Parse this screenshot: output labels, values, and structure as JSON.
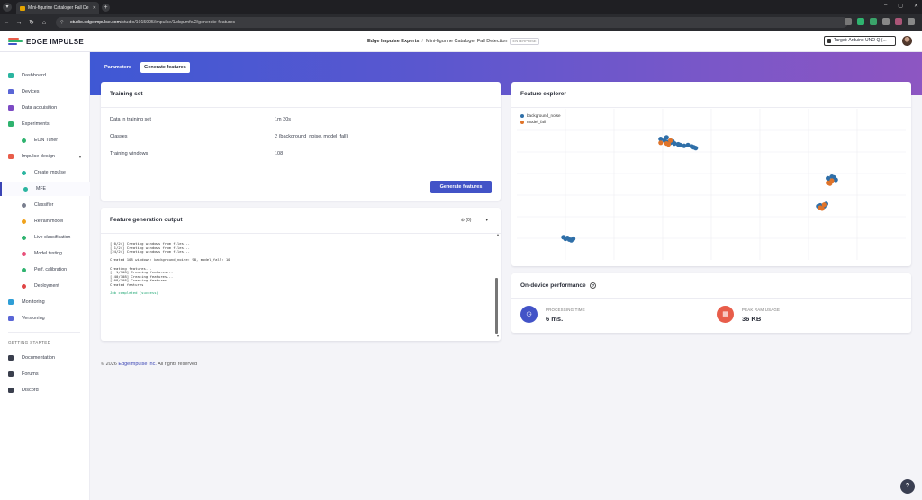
{
  "browser": {
    "tab_title": "Mini-figurine Cataloger Fall De",
    "tab_close": "✕",
    "new_tab": "+",
    "url_host": "studio.edgeimpulse.com",
    "url_path": "/studio/1015905/impulse/1/dsp/mfe/2/generate-features",
    "controls": {
      "min": "–",
      "max": "▢",
      "close": "✕"
    }
  },
  "header": {
    "logo_text": "EDGE IMPULSE",
    "org": "Edge Impulse Experts",
    "separator": "/",
    "project": "Mini-figurine Cataloger Fall Detection",
    "plan_badge": "ENTERPRISE",
    "target": "Target: Arduino UNO Q (...",
    "brand_color": "#4253c7"
  },
  "sidebar": {
    "items": [
      {
        "label": "Dashboard",
        "icon": "monitor-icon",
        "color": "#2bb5a0"
      },
      {
        "label": "Devices",
        "icon": "devices-icon",
        "color": "#5a66d6"
      },
      {
        "label": "Data acquisition",
        "icon": "database-icon",
        "color": "#7c4bc4"
      },
      {
        "label": "Experiments",
        "icon": "experiments-icon",
        "color": "#2fb36f"
      },
      {
        "label": "EON Tuner",
        "icon": "tuner-icon",
        "color": "#2fb36f"
      },
      {
        "label": "Impulse design",
        "icon": "impulse-icon",
        "color": "#e85d4a"
      },
      {
        "label": "Create impulse",
        "icon": "create-impulse-icon",
        "color": "#2bb5a0"
      },
      {
        "label": "MFE",
        "icon": "mfe-icon",
        "color": "#2bb5a0"
      },
      {
        "label": "Classifier",
        "icon": "classifier-icon",
        "color": "#7a7f8f"
      },
      {
        "label": "Retrain model",
        "icon": "retrain-icon",
        "color": "#f0a21b"
      },
      {
        "label": "Live classification",
        "icon": "live-icon",
        "color": "#2fb36f"
      },
      {
        "label": "Model testing",
        "icon": "testing-icon",
        "color": "#e8507a"
      },
      {
        "label": "Perf. calibration",
        "icon": "calibration-icon",
        "color": "#2fb36f"
      },
      {
        "label": "Deployment",
        "icon": "deployment-icon",
        "color": "#e04545"
      },
      {
        "label": "Monitoring",
        "icon": "monitoring-icon",
        "color": "#2f9ed6"
      },
      {
        "label": "Versioning",
        "icon": "versioning-icon",
        "color": "#5a66d6"
      }
    ],
    "section_label": "GETTING STARTED",
    "getting_started": [
      {
        "label": "Documentation",
        "icon": "documentation-icon"
      },
      {
        "label": "Forums",
        "icon": "forums-icon"
      },
      {
        "label": "Discord",
        "icon": "discord-icon"
      }
    ]
  },
  "tabs": {
    "parameters": "Parameters",
    "generate": "Generate features"
  },
  "training_set": {
    "title": "Training set",
    "rows": [
      {
        "key": "Data in training set",
        "value": "1m 30s"
      },
      {
        "key": "Classes",
        "value": "2 (background_noise, model_fall)"
      },
      {
        "key": "Training windows",
        "value": "108"
      }
    ],
    "button": "Generate features"
  },
  "output": {
    "title": "Feature generation output",
    "filter_count": "(0)",
    "lines": [
      "[ 0/24] Creating windows from files...",
      "[ 1/24] Creating windows from files...",
      "[24/24] Creating windows from files...",
      "",
      "Created 108 windows: background_noise: 98, model_fall: 10",
      "",
      "Creating features...",
      "[  1/108] Creating features...",
      "[ 40/108] Creating features...",
      "[108/108] Creating features...",
      "Created features",
      "",
      "Job completed (success)"
    ]
  },
  "feature_explorer": {
    "title": "Feature explorer",
    "legend": [
      {
        "name": "background_noise",
        "color": "#2f6fa8"
      },
      {
        "name": "model_fall",
        "color": "#e0742a"
      }
    ]
  },
  "chart_data": {
    "type": "scatter",
    "title": "",
    "xlabel": "",
    "ylabel": "",
    "xlim": [
      0,
      1
    ],
    "ylim": [
      0,
      1
    ],
    "grid": true,
    "legend_position": "top-left",
    "series": [
      {
        "name": "background_noise",
        "points": [
          [
            0.37,
            0.8
          ],
          [
            0.38,
            0.79
          ],
          [
            0.385,
            0.81
          ],
          [
            0.39,
            0.78
          ],
          [
            0.4,
            0.785
          ],
          [
            0.395,
            0.775
          ],
          [
            0.42,
            0.76
          ],
          [
            0.43,
            0.755
          ],
          [
            0.44,
            0.76
          ],
          [
            0.45,
            0.75
          ],
          [
            0.455,
            0.745
          ],
          [
            0.46,
            0.74
          ],
          [
            0.415,
            0.765
          ],
          [
            0.405,
            0.77
          ],
          [
            0.8,
            0.54
          ],
          [
            0.81,
            0.55
          ],
          [
            0.82,
            0.53
          ],
          [
            0.815,
            0.545
          ],
          [
            0.805,
            0.52
          ],
          [
            0.78,
            0.36
          ],
          [
            0.79,
            0.355
          ],
          [
            0.795,
            0.37
          ],
          [
            0.785,
            0.35
          ],
          [
            0.775,
            0.355
          ],
          [
            0.12,
            0.15
          ],
          [
            0.125,
            0.14
          ],
          [
            0.13,
            0.145
          ],
          [
            0.14,
            0.13
          ],
          [
            0.145,
            0.14
          ],
          [
            0.135,
            0.135
          ]
        ]
      },
      {
        "name": "model_fall",
        "points": [
          [
            0.385,
            0.77
          ],
          [
            0.39,
            0.765
          ],
          [
            0.8,
            0.51
          ],
          [
            0.805,
            0.505
          ],
          [
            0.78,
            0.345
          ],
          [
            0.785,
            0.34
          ],
          [
            0.395,
            0.79
          ],
          [
            0.81,
            0.525
          ],
          [
            0.79,
            0.365
          ],
          [
            0.37,
            0.775
          ]
        ]
      }
    ]
  },
  "performance": {
    "title": "On-device performance",
    "info_icon": "?",
    "metrics": [
      {
        "label": "PROCESSING TIME",
        "value": "6 ms.",
        "icon": "clock-icon",
        "color": "#4253c7"
      },
      {
        "label": "PEAK RAM USAGE",
        "value": "36 KB",
        "icon": "ram-icon",
        "color": "#e85d4a"
      }
    ]
  },
  "footer": {
    "prefix": "© 2026",
    "link": "EdgeImpulse Inc.",
    "suffix": "All rights reserved"
  },
  "help": "?"
}
